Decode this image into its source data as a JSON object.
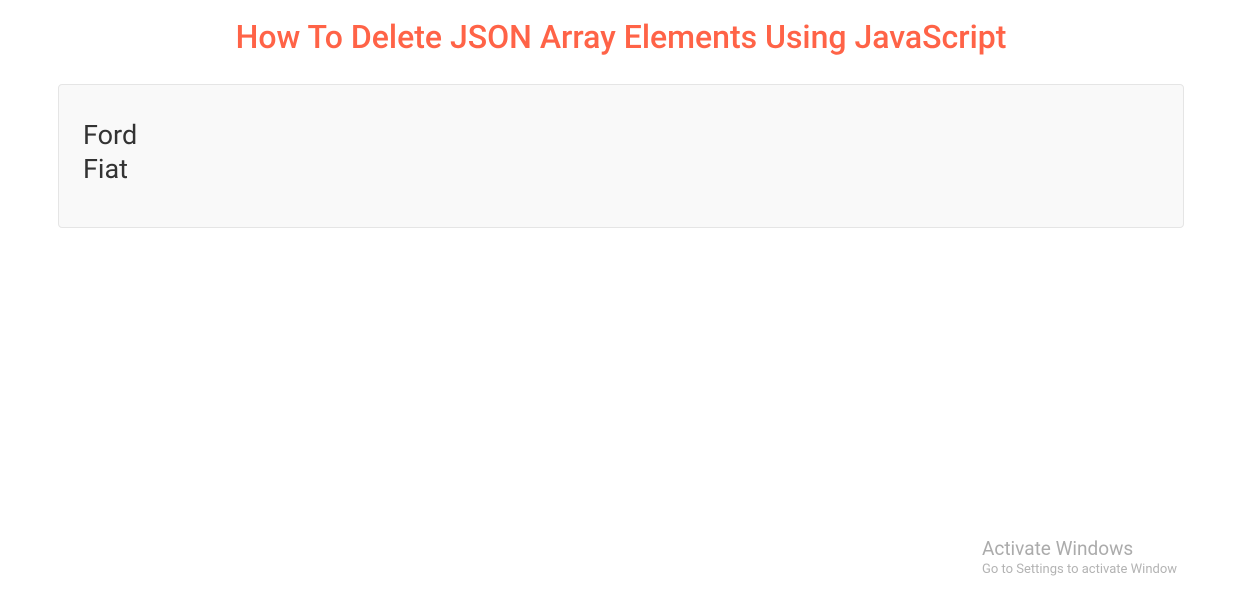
{
  "title": "How To Delete JSON Array Elements Using JavaScript",
  "output": {
    "items": [
      "Ford",
      "Fiat"
    ]
  },
  "watermark": {
    "title": "Activate Windows",
    "subtitle": "Go to Settings to activate Window"
  }
}
